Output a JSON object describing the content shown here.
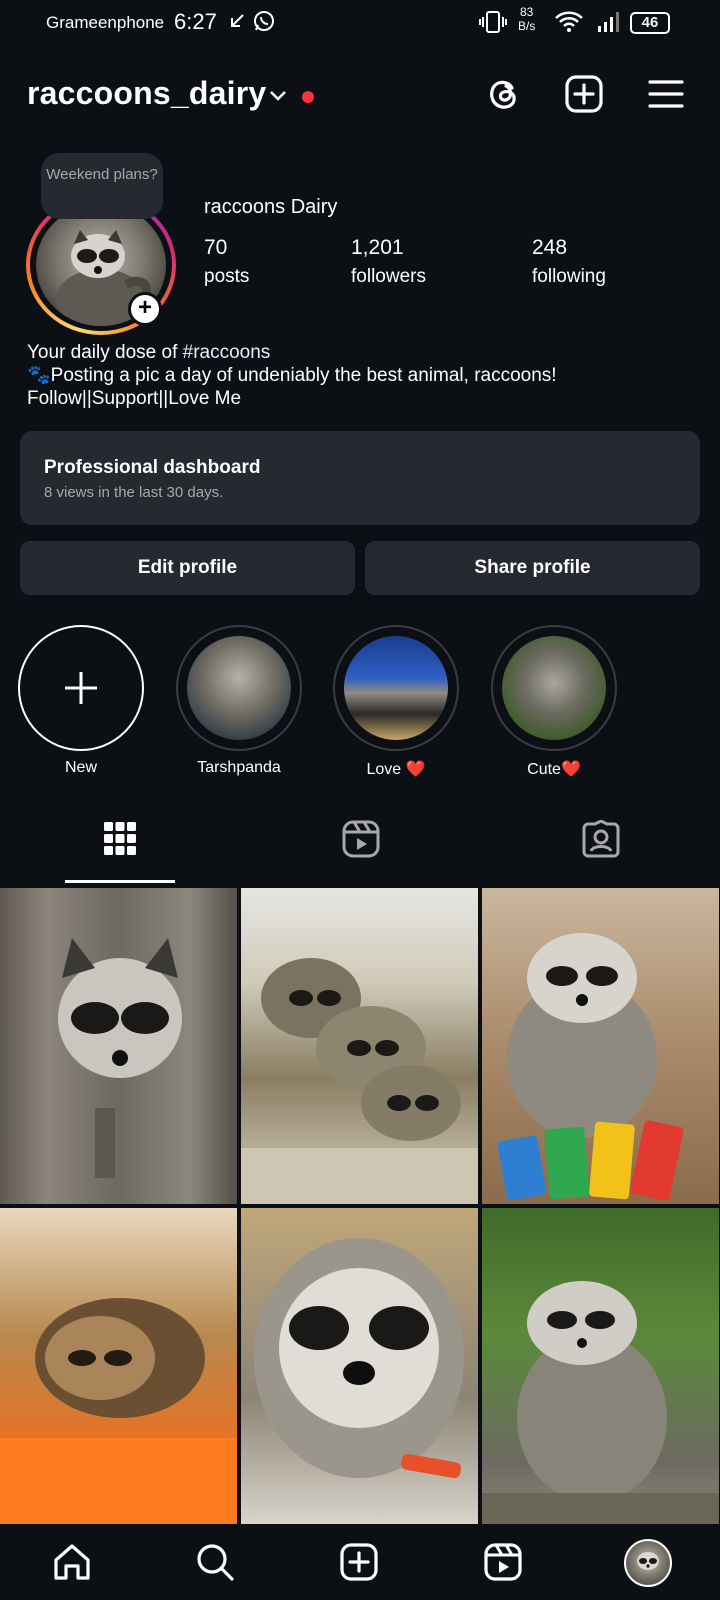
{
  "status_bar": {
    "carrier": "Grameenphone",
    "time": "6:27",
    "net_speed_value": "83",
    "net_speed_unit": "B/s",
    "battery": "46"
  },
  "header": {
    "username": "raccoons_dairy"
  },
  "profile": {
    "note": "Weekend plans?",
    "display_name": "raccoons Dairy",
    "stats": [
      {
        "value": "70",
        "label": "posts"
      },
      {
        "value": "1,201",
        "label": "followers"
      },
      {
        "value": "248",
        "label": "following"
      }
    ],
    "bio_line1_prefix": "Your daily dose of ",
    "bio_hashtag": "#raccoons",
    "bio_line2": "🐾Posting a pic a day of undeniably the best animal, raccoons!",
    "bio_line3": "Follow||Support||Love Me"
  },
  "dashboard": {
    "title": "Professional dashboard",
    "subtitle": "8 views in the last 30 days."
  },
  "buttons": {
    "edit": "Edit profile",
    "share": "Share profile"
  },
  "highlights": [
    {
      "label": "New"
    },
    {
      "label": "Tarshpanda"
    },
    {
      "label": "Love ❤️"
    },
    {
      "label": "Cute❤️"
    }
  ],
  "colors": {
    "background": "#0c1014",
    "surface": "#262a30",
    "notification_dot": "#ff3040",
    "hashtag": "#e0f1ff"
  },
  "icons": {
    "header": [
      "threads-icon",
      "create-post-icon",
      "menu-icon"
    ],
    "tabs": [
      "grid-icon",
      "reels-icon",
      "tagged-icon"
    ],
    "bottom_nav": [
      "home-icon",
      "search-icon",
      "create-icon",
      "reels-icon",
      "profile-avatar"
    ]
  }
}
